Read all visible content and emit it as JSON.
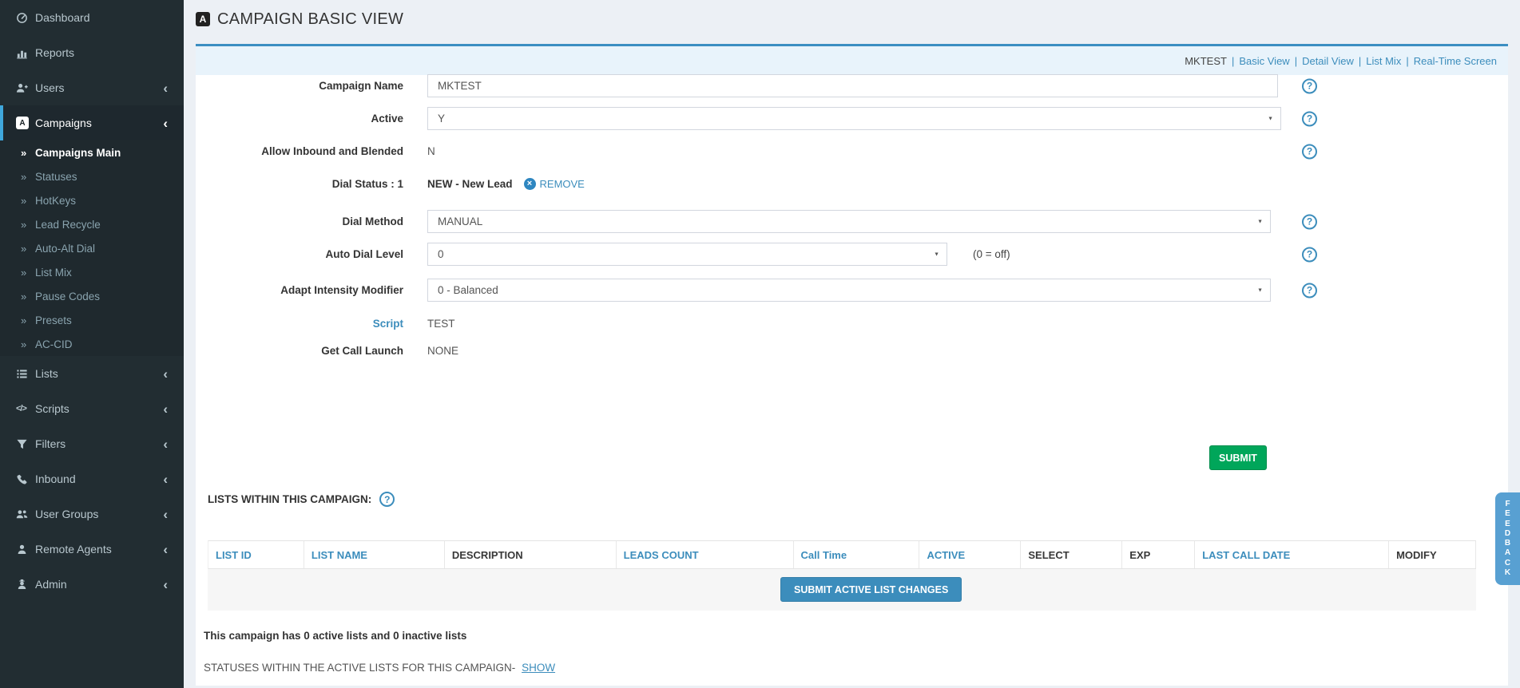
{
  "sidebar": {
    "items": {
      "dashboard": "Dashboard",
      "reports": "Reports",
      "users": "Users",
      "campaigns": "Campaigns",
      "lists": "Lists",
      "scripts": "Scripts",
      "filters": "Filters",
      "inbound": "Inbound",
      "user_groups": "User Groups",
      "remote_agents": "Remote Agents",
      "admin": "Admin"
    },
    "campaigns_icon_letter": "A",
    "campaigns_submenu": [
      "Campaigns Main",
      "Statuses",
      "HotKeys",
      "Lead Recycle",
      "Auto-Alt Dial",
      "List Mix",
      "Pause Codes",
      "Presets",
      "AC-CID"
    ]
  },
  "header": {
    "title": "CAMPAIGN BASIC VIEW",
    "icon_letter": "A"
  },
  "breadcrumb": {
    "current": "MKTEST",
    "separator": "|",
    "links": [
      "Basic View",
      "Detail View",
      "List Mix",
      "Real-Time Screen"
    ]
  },
  "form": {
    "campaign_name": {
      "label": "Campaign Name",
      "value": "MKTEST"
    },
    "active": {
      "label": "Active",
      "value": "Y"
    },
    "allow_inbound": {
      "label": "Allow Inbound and Blended",
      "value": "N"
    },
    "dial_status": {
      "label": "Dial Status : 1",
      "value": "NEW - New Lead",
      "remove_label": "REMOVE"
    },
    "dial_method": {
      "label": "Dial Method",
      "value": "MANUAL"
    },
    "auto_dial_level": {
      "label": "Auto Dial Level",
      "value": "0",
      "note": "(0 = off)"
    },
    "adapt_intensity": {
      "label": "Adapt Intensity Modifier",
      "value": "0 - Balanced"
    },
    "script": {
      "label": "Script",
      "value": "TEST"
    },
    "get_call_launch": {
      "label": "Get Call Launch",
      "value": "NONE"
    },
    "submit_label": "SUBMIT"
  },
  "lists_section": {
    "heading": "LISTS WITHIN THIS CAMPAIGN:",
    "columns": [
      "LIST ID",
      "LIST NAME",
      "DESCRIPTION",
      "LEADS COUNT",
      "Call Time",
      "ACTIVE",
      "SELECT",
      "EXP",
      "LAST CALL DATE",
      "MODIFY"
    ],
    "submit_button": "SUBMIT ACTIVE LIST CHANGES",
    "summary": "This campaign has 0 active lists and 0 inactive lists",
    "statuses_prefix": "STATUSES WITHIN THE ACTIVE LISTS FOR THIS CAMPAIGN-",
    "show_label": "SHOW"
  },
  "feedback_tab": {
    "label": "FEEDBACK"
  },
  "glyphs": {
    "help": "?",
    "remove": "×",
    "select_arrow": "▼",
    "chevron_collapsed": "‹",
    "submenu_arrow": "»",
    "scripts_icon": "</>"
  },
  "colors": {
    "accent_blue": "#3c8dbc",
    "panel_top_border": "#3b8ec2",
    "band_blue": "#e8f3fb",
    "submit_green": "#00a65a",
    "button_blue": "#3c8dbc",
    "feedback_blue": "#58a0d2",
    "sidebar_bg": "#222d32",
    "sidebar_active_bar": "#3fa7dc"
  }
}
